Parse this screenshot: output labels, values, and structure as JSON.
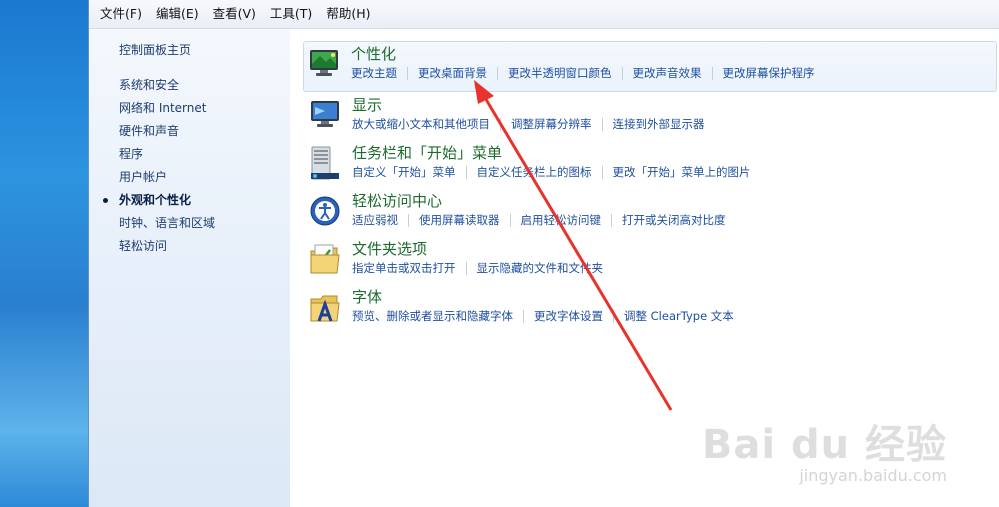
{
  "menu": [
    "文件(F)",
    "编辑(E)",
    "查看(V)",
    "工具(T)",
    "帮助(H)"
  ],
  "sidebar": {
    "home": "控制面板主页",
    "items": [
      {
        "label": "系统和安全",
        "active": false
      },
      {
        "label": "网络和 Internet",
        "active": false
      },
      {
        "label": "硬件和声音",
        "active": false
      },
      {
        "label": "程序",
        "active": false
      },
      {
        "label": "用户帐户",
        "active": false
      },
      {
        "label": "外观和个性化",
        "active": true
      },
      {
        "label": "时钟、语言和区域",
        "active": false
      },
      {
        "label": "轻松访问",
        "active": false
      }
    ]
  },
  "categories": [
    {
      "title": "个性化",
      "icon": "personalization-icon",
      "links": [
        "更改主题",
        "更改桌面背景",
        "更改半透明窗口颜色",
        "更改声音效果",
        "更改屏幕保护程序"
      ]
    },
    {
      "title": "显示",
      "icon": "display-icon",
      "links": [
        "放大或缩小文本和其他项目",
        "调整屏幕分辨率",
        "连接到外部显示器"
      ]
    },
    {
      "title": "任务栏和「开始」菜单",
      "icon": "taskbar-icon",
      "links": [
        "自定义「开始」菜单",
        "自定义任务栏上的图标",
        "更改「开始」菜单上的图片"
      ]
    },
    {
      "title": "轻松访问中心",
      "icon": "ease-of-access-icon",
      "links": [
        "适应弱视",
        "使用屏幕读取器",
        "启用轻松访问键",
        "打开或关闭高对比度"
      ]
    },
    {
      "title": "文件夹选项",
      "icon": "folder-options-icon",
      "links": [
        "指定单击或双击打开",
        "显示隐藏的文件和文件夹"
      ]
    },
    {
      "title": "字体",
      "icon": "fonts-icon",
      "links": [
        "预览、删除或者显示和隐藏字体",
        "更改字体设置",
        "调整 ClearType 文本"
      ]
    }
  ],
  "watermark": {
    "main": "Bai du 经验",
    "sub": "jingyan.baidu.com"
  },
  "colors": {
    "link": "#1f4f9e",
    "title": "#1b6b2e",
    "arrow": "#e8322b"
  }
}
